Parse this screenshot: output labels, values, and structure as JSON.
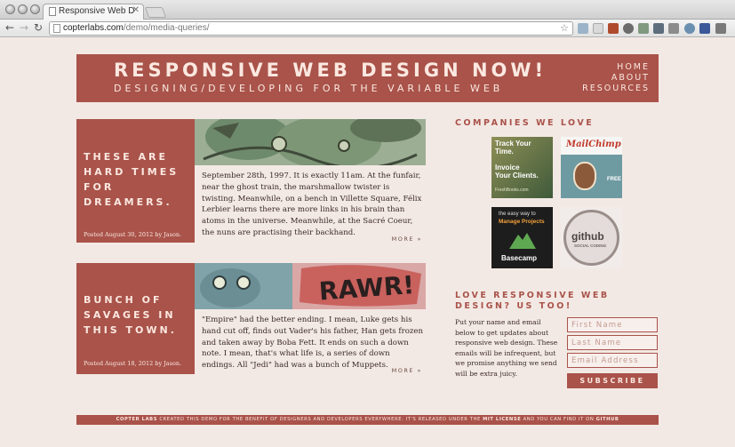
{
  "browser": {
    "tab_title": "Responsive Web Design Now",
    "tab_close": "✕",
    "url_host": "copterlabs.com",
    "url_path": "/demo/media-queries/"
  },
  "header": {
    "title": "RESPONSIVE WEB DESIGN NOW!",
    "subtitle": "DESIGNING/DEVELOPING FOR THE VARIABLE WEB",
    "nav": [
      "HOME",
      "ABOUT",
      "RESOURCES"
    ]
  },
  "posts": [
    {
      "title": "THESE ARE HARD TIMES FOR DREAMERS.",
      "meta": "Posted August 30, 2012 by Jason.",
      "body": "September 28th, 1997. It is exactly 11am. At the funfair, near the ghost train, the marshmallow twister is twisting. Meanwhile, on a bench in Villette Square, Félix Lerbier learns there are more links in his brain than atoms in the universe. Meanwhile, at the Sacré Coeur, the nuns are practising their backhand.",
      "more": "MORE »"
    },
    {
      "title": "BUNCH OF SAVAGES IN THIS TOWN.",
      "meta": "Posted August 18, 2012 by Jason.",
      "body": "\"Empire\" had the better ending. I mean, Luke gets his hand cut off, finds out Vader's his father, Han gets frozen and taken away by Boba Fett. It ends on such a down note. I mean, that's what life is, a series of down endings. All \"Jedi\" had was a bunch of Muppets.",
      "more": "MORE »",
      "image_text": "RAWR!"
    }
  ],
  "sidebar": {
    "companies_heading": "COMPANIES WE LOVE",
    "logos": {
      "freshbooks": [
        "Track Your",
        "Time.",
        "Invoice",
        "Your Clients.",
        "FreshBooks.com"
      ],
      "mailchimp": "MailChimp",
      "mailchimp_badge": "FREE",
      "basecamp_tag": [
        "the easy way to",
        "Manage Projects"
      ],
      "basecamp": "Basecamp",
      "github": "github",
      "github_tag": "SOCIAL CODING"
    },
    "signup_heading": "LOVE RESPONSIVE WEB DESIGN? US TOO!",
    "signup_text": "Put your name and email below to get updates about responsive web design. These emails will be infrequent, but we promise anything we send will be extra juicy.",
    "first_name_placeholder": "First Name",
    "last_name_placeholder": "Last Name",
    "email_placeholder": "Email Address",
    "subscribe_label": "SUBSCRIBE"
  },
  "footer": {
    "brand": "COPTER LABS",
    "text1": "CREATED THIS DEMO FOR THE BENEFIT OF DESIGNERS AND DEVELOPERS EVERYWHERE. IT'S RELEASED UNDER THE",
    "license": "MIT LICENSE",
    "text2": "AND YOU CAN FIND IT ON",
    "github": "GITHUB"
  },
  "colors": {
    "brand": "#a9534a",
    "page_bg": "#f3e9e4",
    "text": "#3a2a26"
  }
}
